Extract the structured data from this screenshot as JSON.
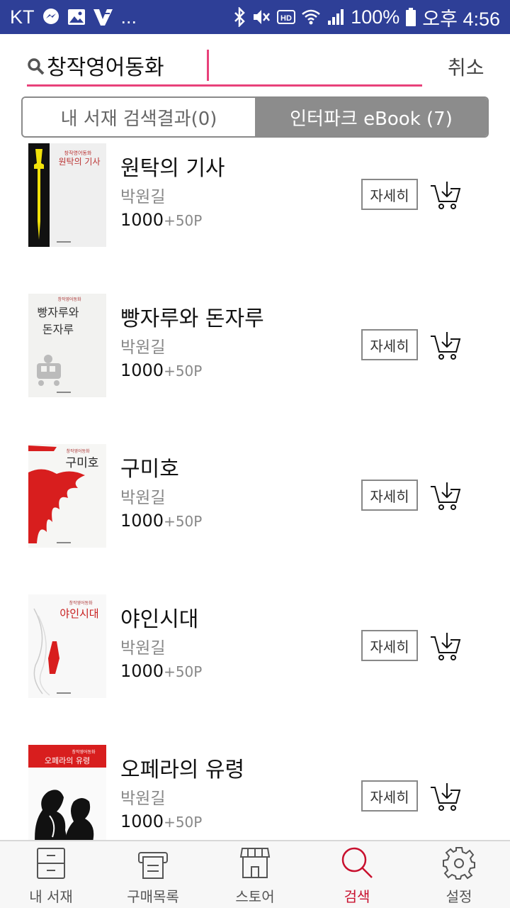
{
  "status_bar": {
    "carrier": "KT",
    "more": "...",
    "battery": "100%",
    "time": "오후 4:56"
  },
  "search": {
    "value": "창작영어동화",
    "cancel_label": "취소"
  },
  "tabs": [
    {
      "label": "내 서재 검색결과(0)",
      "active": false
    },
    {
      "label": "인터파크 eBook (7)",
      "active": true
    }
  ],
  "books": [
    {
      "title": "원탁의 기사",
      "author": "박원길",
      "price": "1000",
      "points": "+50P",
      "detail_label": "자세히",
      "cover_series": "창작영어동화",
      "cover_title": "원탁의 기사"
    },
    {
      "title": "빵자루와 돈자루",
      "author": "박원길",
      "price": "1000",
      "points": "+50P",
      "detail_label": "자세히",
      "cover_series": "창작영어동화",
      "cover_title_line1": "빵자루와",
      "cover_title_line2": "돈자루"
    },
    {
      "title": "구미호",
      "author": "박원길",
      "price": "1000",
      "points": "+50P",
      "detail_label": "자세히",
      "cover_series": "창작영어동화",
      "cover_title": "구미호"
    },
    {
      "title": "야인시대",
      "author": "박원길",
      "price": "1000",
      "points": "+50P",
      "detail_label": "자세히",
      "cover_series": "창작영어동화",
      "cover_title": "야인시대"
    },
    {
      "title": "오페라의 유령",
      "author": "박원길",
      "price": "1000",
      "points": "+50P",
      "detail_label": "자세히",
      "cover_series": "창작영어동화",
      "cover_title": "오페라의 유령"
    }
  ],
  "bottom_nav": [
    {
      "label": "내 서재",
      "icon": "bookshelf-icon"
    },
    {
      "label": "구매목록",
      "icon": "purchase-list-icon"
    },
    {
      "label": "스토어",
      "icon": "store-icon"
    },
    {
      "label": "검색",
      "icon": "search-icon",
      "active": true
    },
    {
      "label": "설정",
      "icon": "gear-icon"
    }
  ],
  "colors": {
    "status_bar": "#2e3f97",
    "accent": "#e8417a",
    "active_tab": "#8c8c8c",
    "active_nav": "#c8102e"
  }
}
